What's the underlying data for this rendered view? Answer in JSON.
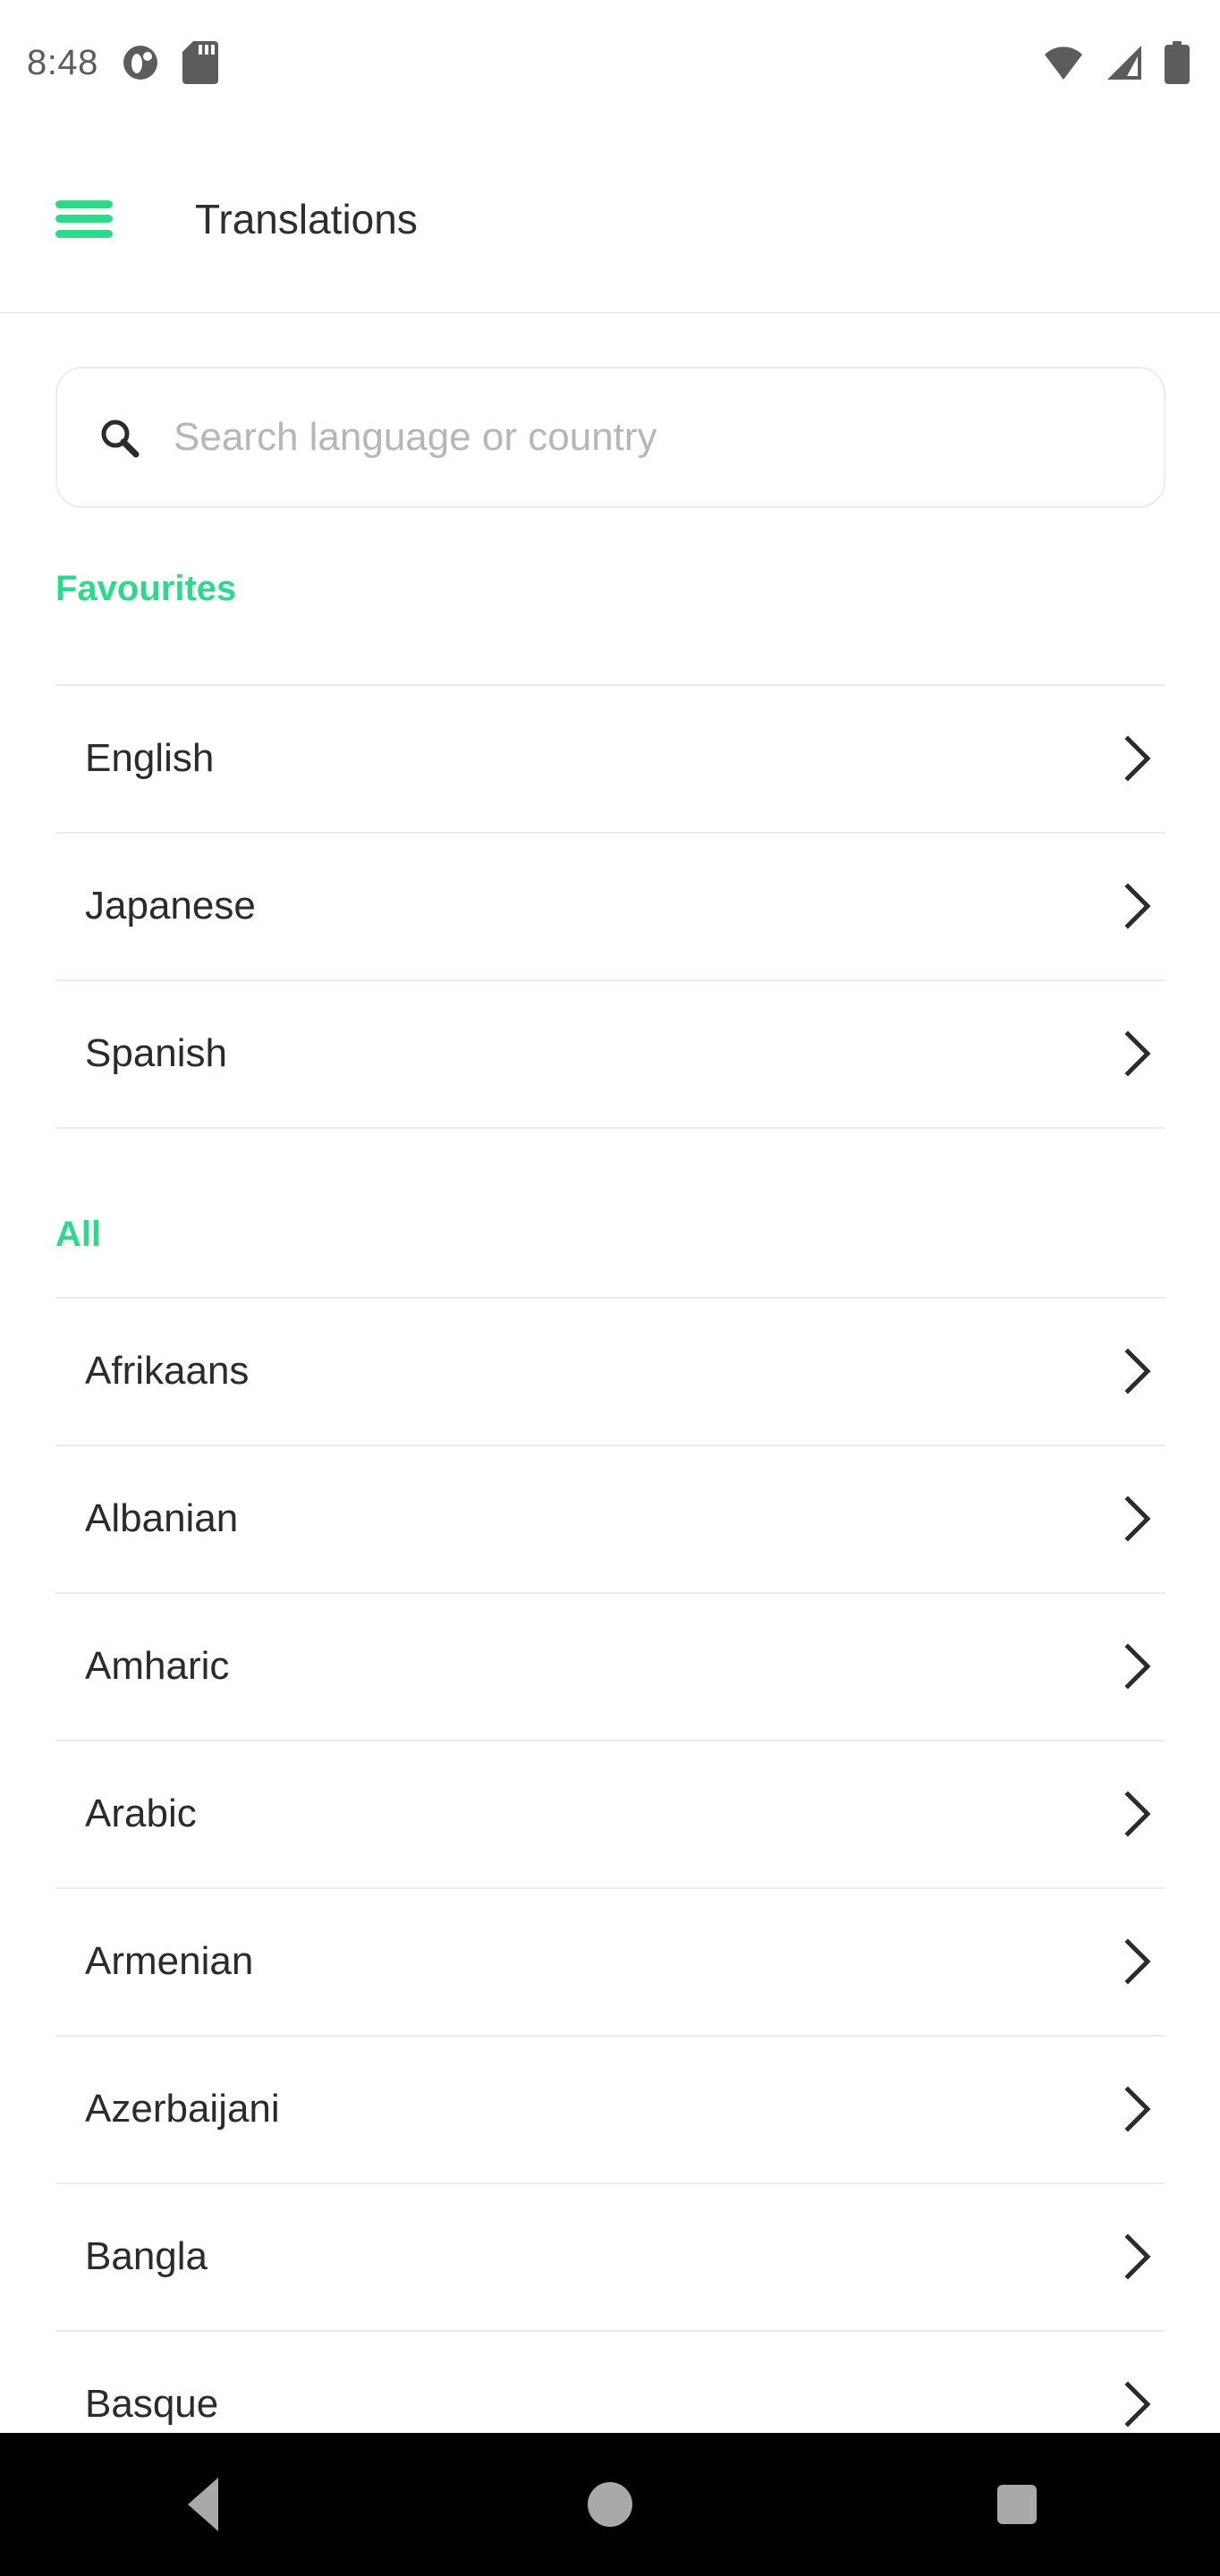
{
  "status_bar": {
    "time": "8:48",
    "left_icons": [
      "notification-circle-icon",
      "sd-card-icon"
    ],
    "right_icons": [
      "wifi-icon",
      "cellular-signal-icon",
      "battery-icon"
    ]
  },
  "app_bar": {
    "menu_icon": "hamburger-menu-icon",
    "title": "Translations"
  },
  "search": {
    "icon": "search-icon",
    "placeholder": "Search language or country",
    "value": ""
  },
  "sections": [
    {
      "title": "Favourites",
      "items": [
        {
          "label": "English"
        },
        {
          "label": "Japanese"
        },
        {
          "label": "Spanish"
        }
      ]
    },
    {
      "title": "All",
      "items": [
        {
          "label": "Afrikaans"
        },
        {
          "label": "Albanian"
        },
        {
          "label": "Amharic"
        },
        {
          "label": "Arabic"
        },
        {
          "label": "Armenian"
        },
        {
          "label": "Azerbaijani"
        },
        {
          "label": "Bangla"
        },
        {
          "label": "Basque"
        }
      ]
    }
  ],
  "nav_bar": {
    "back": "back-nav-icon",
    "home": "home-nav-icon",
    "recents": "recents-nav-icon"
  },
  "colors": {
    "accent_green": "#2fd98c",
    "text_primary": "#2b2b2b",
    "placeholder": "#b6b6b6",
    "divider": "#ebebeb"
  }
}
